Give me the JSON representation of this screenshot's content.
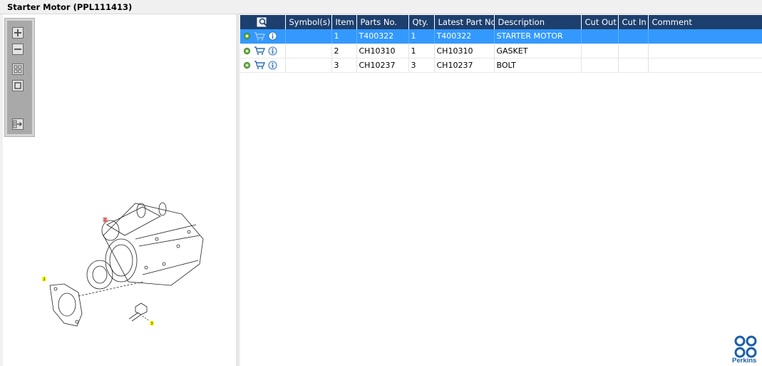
{
  "window": {
    "title": "Starter Motor (PPL111413)"
  },
  "toolbar": {
    "buttons": [
      {
        "name": "zoom-in",
        "icon": "plus-icon"
      },
      {
        "name": "zoom-out",
        "icon": "minus-icon"
      },
      {
        "name": "fit-all",
        "icon": "grid-icon"
      },
      {
        "name": "actual-size",
        "icon": "square-icon"
      },
      {
        "name": "export",
        "icon": "export-icon"
      }
    ]
  },
  "drawing": {
    "callouts": [
      "1",
      "2",
      "3"
    ]
  },
  "table": {
    "columns": [
      "Symbol(s)",
      "Item",
      "Parts No.",
      "Qty.",
      "Latest Part No.",
      "Description",
      "Cut Out",
      "Cut In",
      "Comment"
    ],
    "rows": [
      {
        "symbols": "",
        "item": "1",
        "part_no": "T400322",
        "qty": "1",
        "latest_part_no": "T400322",
        "description": "STARTER MOTOR",
        "cut_out": "",
        "cut_in": "",
        "comment": "",
        "selected": true
      },
      {
        "symbols": "",
        "item": "2",
        "part_no": "CH10310",
        "qty": "1",
        "latest_part_no": "CH10310",
        "description": "GASKET",
        "cut_out": "",
        "cut_in": "",
        "comment": "",
        "selected": false
      },
      {
        "symbols": "",
        "item": "3",
        "part_no": "CH10237",
        "qty": "3",
        "latest_part_no": "CH10237",
        "description": "BOLT",
        "cut_out": "",
        "cut_in": "",
        "comment": "",
        "selected": false
      }
    ]
  },
  "brand": {
    "name": "Perkins",
    "color": "#1d5fa8"
  },
  "colors": {
    "header": "#1d3f6e",
    "selected": "#3399ff",
    "callout": "#ffff00"
  }
}
